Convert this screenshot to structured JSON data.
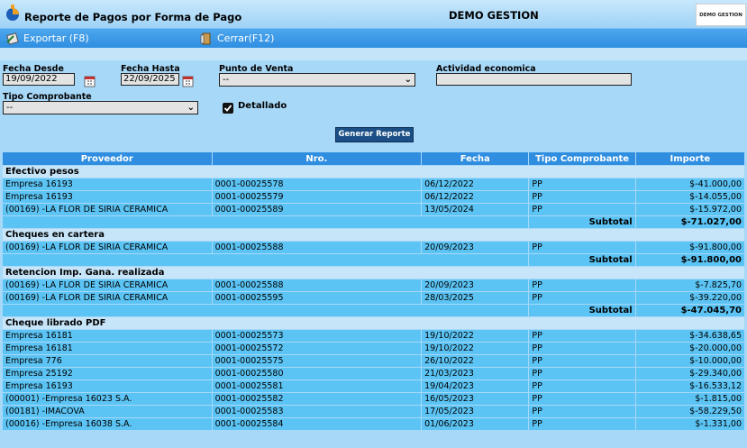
{
  "window": {
    "title": "Reporte de Pagos por Forma de Pago",
    "company": "DEMO GESTION",
    "logo_text": "DEMO GESTION"
  },
  "toolbar": {
    "export_label": "Exportar (F8)",
    "close_label": "Cerrar(F12)"
  },
  "filters": {
    "fecha_desde_label": "Fecha Desde",
    "fecha_desde_value": "19/09/2022",
    "fecha_hasta_label": "Fecha Hasta",
    "fecha_hasta_value": "22/09/2025",
    "punto_venta_label": "Punto de Venta",
    "punto_venta_value": "--",
    "actividad_label": "Actividad economica",
    "actividad_value": "",
    "tipo_comprobante_label": "Tipo Comprobante",
    "tipo_comprobante_value": "--",
    "detallado_label": "Detallado",
    "detallado_checked": true,
    "generate_label": "Generar Reporte"
  },
  "table": {
    "headers": [
      "Proveedor",
      "Nro.",
      "Fecha",
      "Tipo Comprobante",
      "Importe"
    ],
    "subtotal_label": "Subtotal",
    "groups": [
      {
        "name": "Efectivo pesos",
        "rows": [
          [
            "Empresa 16193",
            "0001-00025578",
            "06/12/2022",
            "PP",
            "$-41.000,00"
          ],
          [
            "Empresa 16193",
            "0001-00025579",
            "06/12/2022",
            "PP",
            "$-14.055,00"
          ],
          [
            "(00169) -LA FLOR DE SIRIA CERAMICA",
            "0001-00025589",
            "13/05/2024",
            "PP",
            "$-15.972,00"
          ]
        ],
        "subtotal": "$-71.027,00"
      },
      {
        "name": "Cheques en cartera",
        "rows": [
          [
            "(00169) -LA FLOR DE SIRIA CERAMICA",
            "0001-00025588",
            "20/09/2023",
            "PP",
            "$-91.800,00"
          ]
        ],
        "subtotal": "$-91.800,00"
      },
      {
        "name": "Retencion Imp. Gana. realizada",
        "rows": [
          [
            "(00169) -LA FLOR DE SIRIA CERAMICA",
            "0001-00025588",
            "20/09/2023",
            "PP",
            "$-7.825,70"
          ],
          [
            "(00169) -LA FLOR DE SIRIA CERAMICA",
            "0001-00025595",
            "28/03/2025",
            "PP",
            "$-39.220,00"
          ]
        ],
        "subtotal": "$-47.045,70"
      },
      {
        "name": "Cheque librado PDF",
        "rows": [
          [
            "Empresa 16181",
            "0001-00025573",
            "19/10/2022",
            "PP",
            "$-34.638,65"
          ],
          [
            "Empresa 16181",
            "0001-00025572",
            "19/10/2022",
            "PP",
            "$-20.000,00"
          ],
          [
            "Empresa 776",
            "0001-00025575",
            "26/10/2022",
            "PP",
            "$-10.000,00"
          ],
          [
            "Empresa 25192",
            "0001-00025580",
            "21/03/2023",
            "PP",
            "$-29.340,00"
          ],
          [
            "Empresa 16193",
            "0001-00025581",
            "19/04/2023",
            "PP",
            "$-16.533,12"
          ],
          [
            "(00001) -Empresa 16023 S.A.",
            "0001-00025582",
            "16/05/2023",
            "PP",
            "$-1.815,00"
          ],
          [
            "(00181) -IMACOVA",
            "0001-00025583",
            "17/05/2023",
            "PP",
            "$-58.229,50"
          ],
          [
            "(00016) -Empresa 16038 S.A.",
            "0001-00025584",
            "01/06/2023",
            "PP",
            "$-1.331,00"
          ]
        ],
        "subtotal": null
      }
    ]
  }
}
